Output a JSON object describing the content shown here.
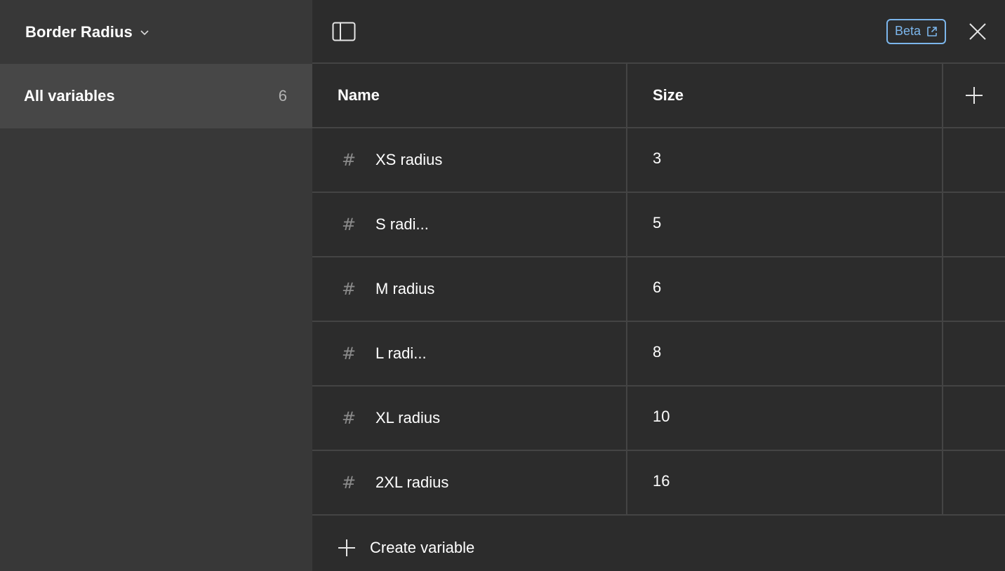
{
  "sidebar": {
    "collection_title": "Border Radius",
    "items": [
      {
        "label": "All variables",
        "count": "6"
      }
    ]
  },
  "topbar": {
    "beta_label": "Beta"
  },
  "table": {
    "headers": {
      "name": "Name",
      "size": "Size"
    },
    "rows": [
      {
        "name": "XS radius",
        "value": "3"
      },
      {
        "name": "S radi...",
        "value": "5"
      },
      {
        "name": "M radius",
        "value": "6"
      },
      {
        "name": "L radi...",
        "value": "8"
      },
      {
        "name": "XL radius",
        "value": "10"
      },
      {
        "name": "2XL radius",
        "value": "16"
      }
    ],
    "create_label": "Create variable"
  },
  "icons": {
    "chevron": "chevron-down-icon",
    "panel_toggle": "sidebar-toggle-icon",
    "external": "external-link-icon",
    "close": "close-icon",
    "hash": "number-variable-icon",
    "plus": "plus-icon"
  },
  "colors": {
    "sidebar_bg": "#383838",
    "sidebar_selected": "#474747",
    "main_bg": "#2c2c2c",
    "border": "#444444",
    "accent": "#7cb6ec"
  }
}
